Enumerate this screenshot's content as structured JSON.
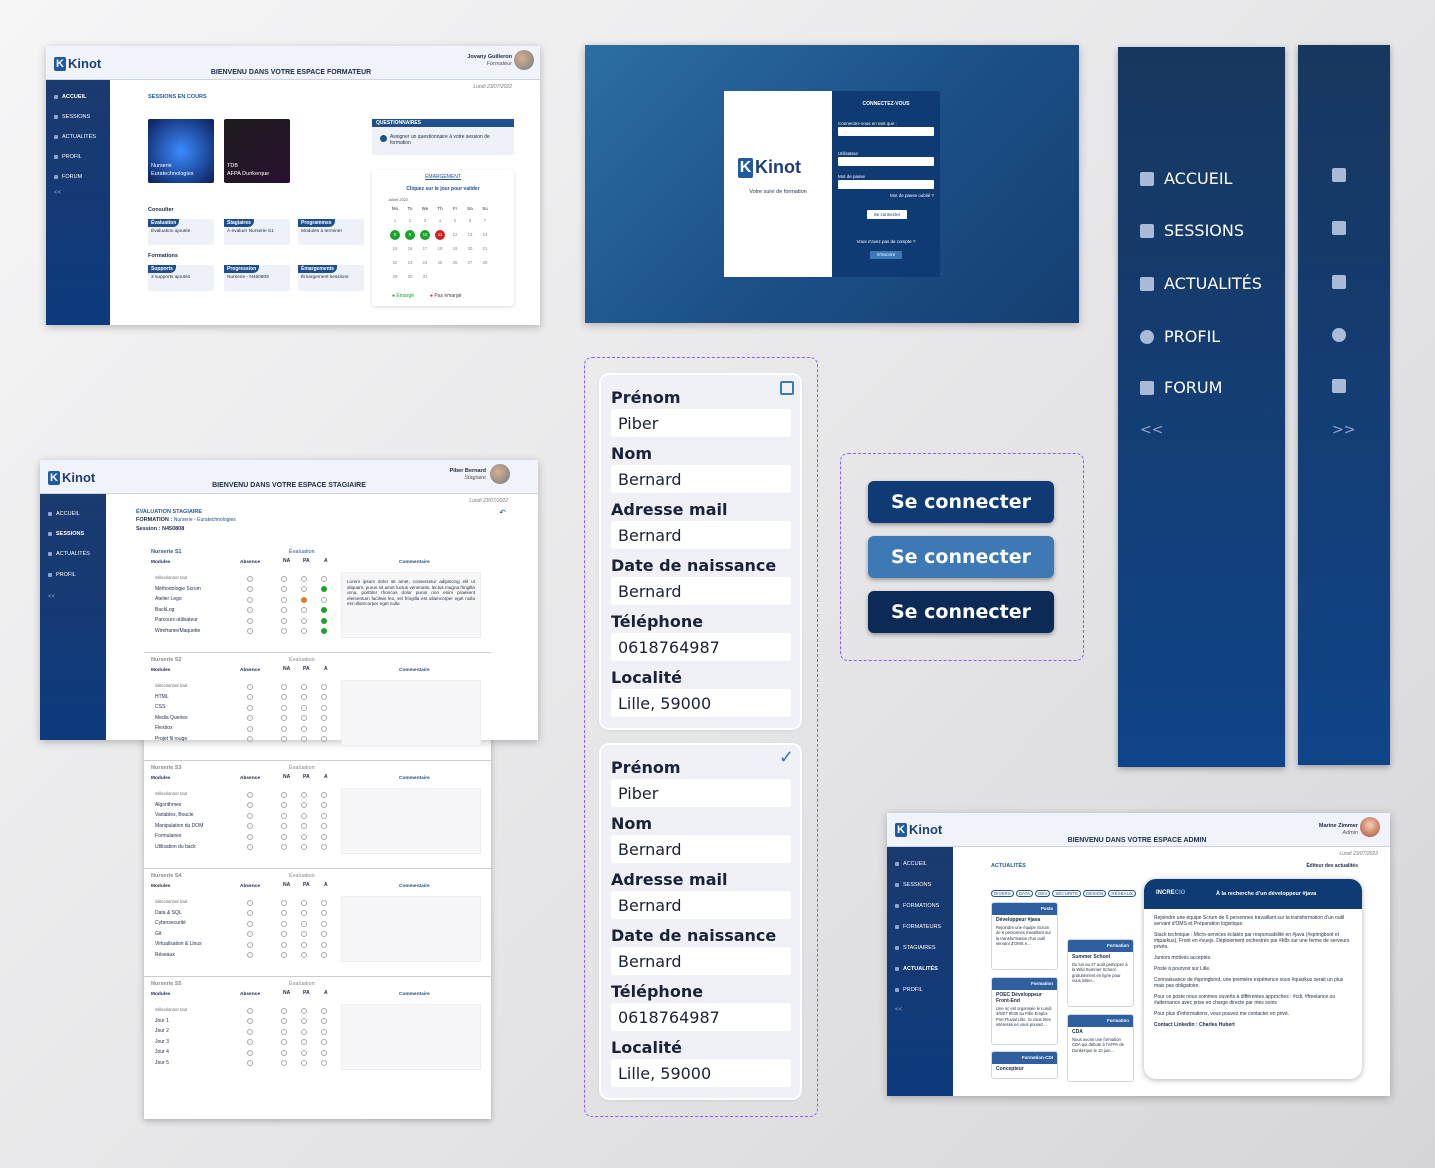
{
  "formateur": {
    "logo": "Kinot",
    "title": "BIENVENU DANS VOTRE ESPACE FORMATEUR",
    "user_name": "Jovany Guilleron",
    "user_role": "Formateur",
    "date": "Lundi 23/07/2022",
    "nav": [
      "ACCUEIL",
      "SESSIONS",
      "ACTUALITÉS",
      "PROFIL",
      "FORUM"
    ],
    "collapse": "<<",
    "sessions_title": "SESSIONS EN COURS",
    "session1_name": "Nurserie",
    "session1_org": "Euratechnologies",
    "session2_name": "TDB",
    "session2_org": "AFPA Dunkerque",
    "consulter": "Consulter",
    "formations": "Formations",
    "cards": [
      {
        "label": "Évaluation",
        "text": "Évaluation ajoutée"
      },
      {
        "label": "Stagiaires",
        "text": "À évaluer Nurserie S1"
      },
      {
        "label": "Programmes",
        "text": "Modules à terminer"
      },
      {
        "label": "Supports",
        "text": "3 supports ajoutés"
      },
      {
        "label": "Progression",
        "text": "Nurserie - N450808"
      },
      {
        "label": "Émargements",
        "text": "Émargement sessions"
      }
    ],
    "quest_title": "QUESTIONNAIRES",
    "quest_text": "Assigner un questionnaire à votre session de formation",
    "cal_title": "ÉMARGEMENT",
    "cal_sub": "Cliquez sur le jour pour valider",
    "cal_month": "Juillet 2022",
    "cal_days": [
      "Mo",
      "Tu",
      "We",
      "Th",
      "Fr",
      "Sa",
      "Su"
    ],
    "cal_legend_ok": "Émargé",
    "cal_legend_no": "Pas émargé"
  },
  "login": {
    "logo": "Kinot",
    "tagline": "Votre suivi de formation",
    "title": "CONNECTEZ-VOUS",
    "role_label": "Connectez-vous en tant que :",
    "user_label": "Utilisateur",
    "pwd_label": "Mot de passe",
    "forgot": "Mot de passe oublié ?",
    "submit": "Se connecter",
    "no_account": "Vous n'avez pas de compte ?",
    "signup": "S'inscrire"
  },
  "bigside": {
    "items": [
      "ACCUEIL",
      "SESSIONS",
      "ACTUALITÉS",
      "PROFIL",
      "FORUM"
    ],
    "collapse": "<<",
    "expand": ">>"
  },
  "stagiaire": {
    "logo": "Kinot",
    "title": "BIENVENU DANS VOTRE ESPACE STAGIAIRE",
    "user_name": "Piber Bernard",
    "user_role": "Stagiaire",
    "date": "Lundi 23/07/2022",
    "nav": [
      "ACCUEIL",
      "SESSIONS",
      "ACTUALITÉS",
      "PROFIL"
    ],
    "collapse": "<<",
    "eval_title": "ÉVALUATION STAGIAIRE",
    "formation_label": "FORMATION :",
    "formation_value": "Nurserie - Euratechnologies",
    "session_label": "Session : N450808",
    "col_modules": "Modules",
    "col_absence": "Absence",
    "col_eval": "Évaluation",
    "col_comment": "Commentaire",
    "na": "NA",
    "pa": "PA",
    "a": "A",
    "select_all": "Sélectionner tout",
    "comment1": "Lorem ipsum dolor sit amet, consectetur adipiscing elit ut aliquam, purus sit amet luctus venenatis, lectus magna fringilla urna, porttitor rhoncus dolor purus non enim praesent elementum facilisis leo, vel fringilla est ullamcorper eget nulla est ullamcorper eget nulla",
    "blocks": [
      {
        "name": "Nurserie S1",
        "modules": [
          "Méthodologie Scrum",
          "Atelier Lego",
          "BackLog",
          "Parcours utilisateur",
          "Wireframe/Maquette"
        ]
      },
      {
        "name": "Nurserie S2",
        "modules": [
          "HTML",
          "CSS",
          "Media Queries",
          "Flexbox",
          "Projet fil rouge"
        ]
      },
      {
        "name": "Nurserie S3",
        "modules": [
          "Algorithmes",
          "Variables, Boucle",
          "Manipulation du DOM",
          "Formulaires",
          "Utilisation du back"
        ]
      },
      {
        "name": "Nurserie S4",
        "modules": [
          "Data & SQL",
          "Cybersecurité",
          "Git",
          "Virtualisation & Linus",
          "Réseaux"
        ]
      },
      {
        "name": "Nurserie S5",
        "modules": [
          "Jour 1",
          "Jour 2",
          "Jour 3",
          "Jour 4",
          "Jour 5"
        ]
      }
    ]
  },
  "profile": {
    "labels": [
      "Prénom",
      "Nom",
      "Adresse mail",
      "Date de naissance",
      "Téléphone",
      "Localité"
    ],
    "values": [
      "Piber",
      "Bernard",
      "Bernard",
      "Bernard",
      "0618764987",
      "Lille, 59000"
    ]
  },
  "buttons": {
    "label": "Se connecter",
    "colors": [
      "#0f3a74",
      "#3d7ab5",
      "#0b2a55"
    ]
  },
  "admin": {
    "logo": "Kinot",
    "title": "BIENVENU DANS VOTRE ESPACE ADMIN",
    "user_name": "Marine Zimmer",
    "user_role": "Admin",
    "date": "Lundi 23/07/2022",
    "nav": [
      "ACCUEIL",
      "SESSIONS",
      "FORMATIONS",
      "FORMATEURS",
      "STAGIAIRES",
      "ACTUALITÉS",
      "PROFIL"
    ],
    "collapse": "<<",
    "section": "ACTUALITÉS",
    "editor": "Éditeur des actualités",
    "tags": [
      "DIVERS",
      "DATA",
      "DEV",
      "SÉCURITÉ",
      "DESIGN",
      "RÉSEAUX"
    ],
    "news": [
      {
        "type": "Poste",
        "title": "Développeur #java",
        "text": "Rejoindre une équipe Scrum de 6 personnes travaillant sur la transformation d'un outil servant d'OMS e..."
      },
      {
        "type": "Formation",
        "title": "Summer School",
        "text": "Du lun au 27 août participez à la Wild Summer School gratuitement en ligne pour vous initier..."
      },
      {
        "type": "Formation",
        "title": "POEC Développeur Front-End",
        "text": "Une nc est organisée le Lundi 3/6/07 8h30 au Pôle Emploi Port Fluvial Lille. Si vous êtes intéressé.es vous pouvez..."
      },
      {
        "type": "Formation",
        "title": "CDA",
        "text": "Nous avons une formation CDA qui débute à l'AFPA de Dunkerque le 10 juin..."
      },
      {
        "type": "Formation-CDI",
        "title": "Concepteur",
        "text": ""
      }
    ],
    "detail_title": "À la recherche d'un développeur #java",
    "detail_paras": [
      "Rejoindre une équipe Scrum de 6 personnes travaillant sur la transformation d'un outil servant d'OMS et Préparation logistique.",
      "Stack technique : Micro-services éclatés par responsabilité en #java (#springboot et #quarkus), Front en #vuejs. Déploiement orchestrés par #k8s sur une ferme de serveurs privés.",
      "Juniors motivés acceptés.",
      "Poste à pourvoir sur Lille.",
      "Connaissance de #springboot, une première expérience sous #quarkus serait un plus mais pas obligatoire.",
      "Pour ce poste nous sommes ouverts à différentes approches : #cdi, #freelance ou #alternance avec prise en charge directe par mes soins",
      "Pour plus d'informations, vous pouvez me contacter en privé.",
      "Contact Linkedin : Charles Hubert"
    ]
  }
}
